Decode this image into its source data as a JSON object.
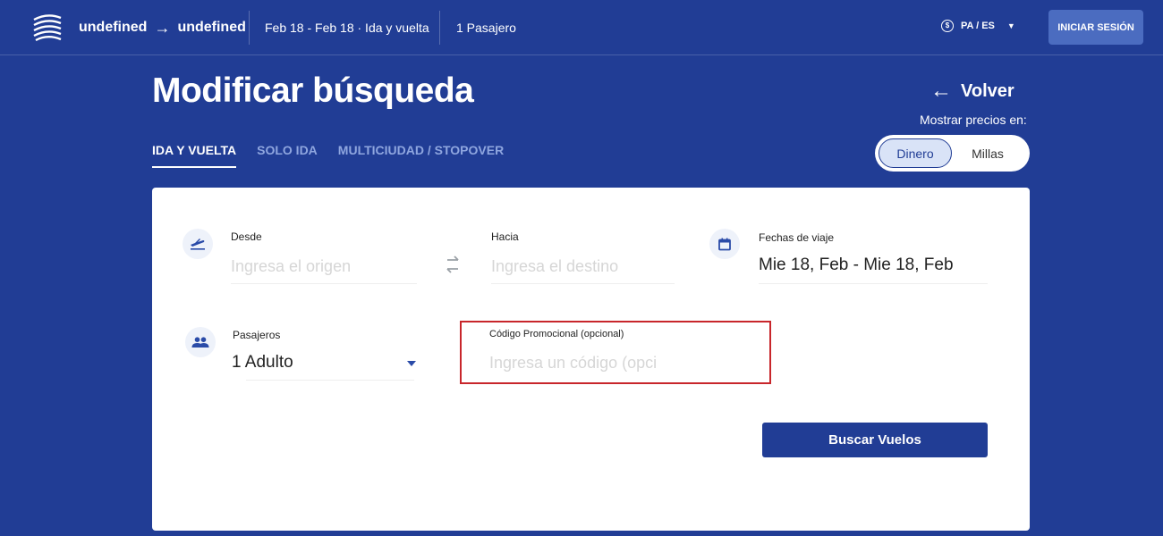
{
  "header": {
    "origin": "undefined",
    "destination": "undefined",
    "route_arrow": "→",
    "trip_summary": "Feb 18 - Feb 18 · Ida y vuelta",
    "passenger_summary": "1 Pasajero",
    "locale": "PA / ES",
    "login_label": "INICIAR SESIÓN"
  },
  "page": {
    "title": "Modificar búsqueda",
    "back_label": "Volver",
    "prices_label": "Mostrar precios en:",
    "currency_options": [
      "Dinero",
      "Millas"
    ],
    "currency_selected": "Dinero"
  },
  "tabs": [
    {
      "label": "IDA Y VUELTA",
      "active": true
    },
    {
      "label": "SOLO IDA",
      "active": false
    },
    {
      "label": "MULTICIUDAD / STOPOVER",
      "active": false
    }
  ],
  "form": {
    "origin": {
      "label": "Desde",
      "placeholder": "Ingresa el origen",
      "value": ""
    },
    "destination": {
      "label": "Hacia",
      "placeholder": "Ingresa el destino",
      "value": ""
    },
    "dates": {
      "label": "Fechas de viaje",
      "value": "Mie 18, Feb - Mie 18, Feb"
    },
    "passengers": {
      "label": "Pasajeros",
      "value": "1 Adulto"
    },
    "promo": {
      "label": "Código Promocional (opcional)",
      "placeholder": "Ingresa un código (opci",
      "value": ""
    },
    "search_label": "Buscar Vuelos"
  },
  "colors": {
    "background": "#213d95",
    "accent": "#213d95",
    "highlight": "#c8262b",
    "inactive_tab": "#8fa6df"
  }
}
